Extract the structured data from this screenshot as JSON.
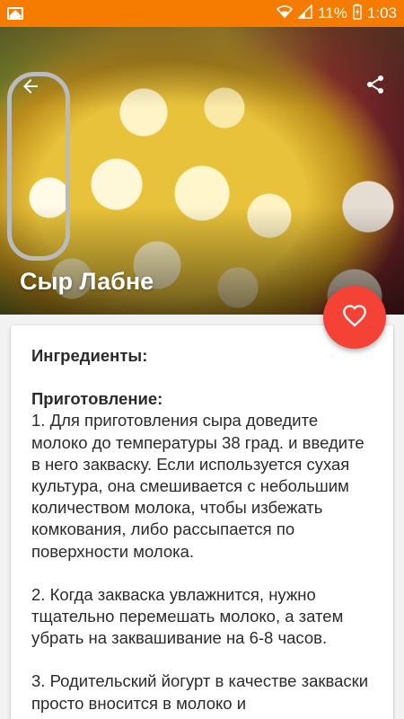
{
  "status_bar": {
    "battery_percent": "11%",
    "time": "1:03",
    "icons": [
      "gallery-notification-icon",
      "wifi-icon",
      "signal-icon",
      "battery-charging-icon"
    ]
  },
  "toolbar": {
    "back_icon": "arrow-back-icon",
    "share_icon": "share-icon"
  },
  "recipe": {
    "title": "Сыр Лабне",
    "ingredients_heading": "Ингредиенты:",
    "preparation_heading": "Приготовление:",
    "steps": [
      "1. Для приготовления сыра доведите молоко до температуры 38 град. и введите в него закваску. Если используется сухая культура, она смешивается с небольшим количеством молока, чтобы избежать комкования, либо рассыпается по поверхности молока.",
      "2. Когда закваска увлажнится, нужно тщательно перемешать молоко, а затем убрать на заквашивание на 6-8 часов.",
      "3. Родительский йогурт в качестве закваски просто вносится в молоко и"
    ]
  },
  "fab": {
    "icon": "heart-outline-icon"
  },
  "colors": {
    "status_bar": "#f57c00",
    "fab": "#f44336",
    "background": "#f2f2f2",
    "card": "#ffffff"
  }
}
